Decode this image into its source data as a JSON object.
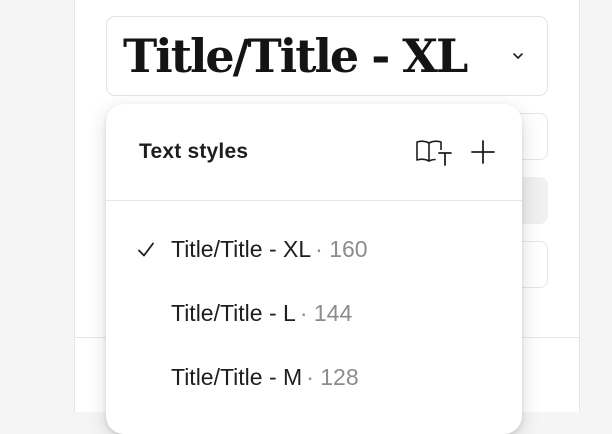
{
  "style_selector": {
    "value": "Title/Title - XL",
    "chevron_icon": "chevron-down-icon"
  },
  "dropdown": {
    "title": "Text styles",
    "library_icon": "library-text-icon",
    "add_icon": "plus-icon",
    "items": [
      {
        "label": "Title/Title - XL",
        "size": "· 160",
        "selected": true
      },
      {
        "label": "Title/Title - L",
        "size": "· 144",
        "selected": false
      },
      {
        "label": "Title/Title - M",
        "size": "· 128",
        "selected": false
      }
    ]
  },
  "colors": {
    "panel": "#ffffff",
    "background": "#f5f5f5",
    "text": "#1e1e1e",
    "muted_text": "#8c8c8c",
    "border": "#e6e6e6"
  }
}
